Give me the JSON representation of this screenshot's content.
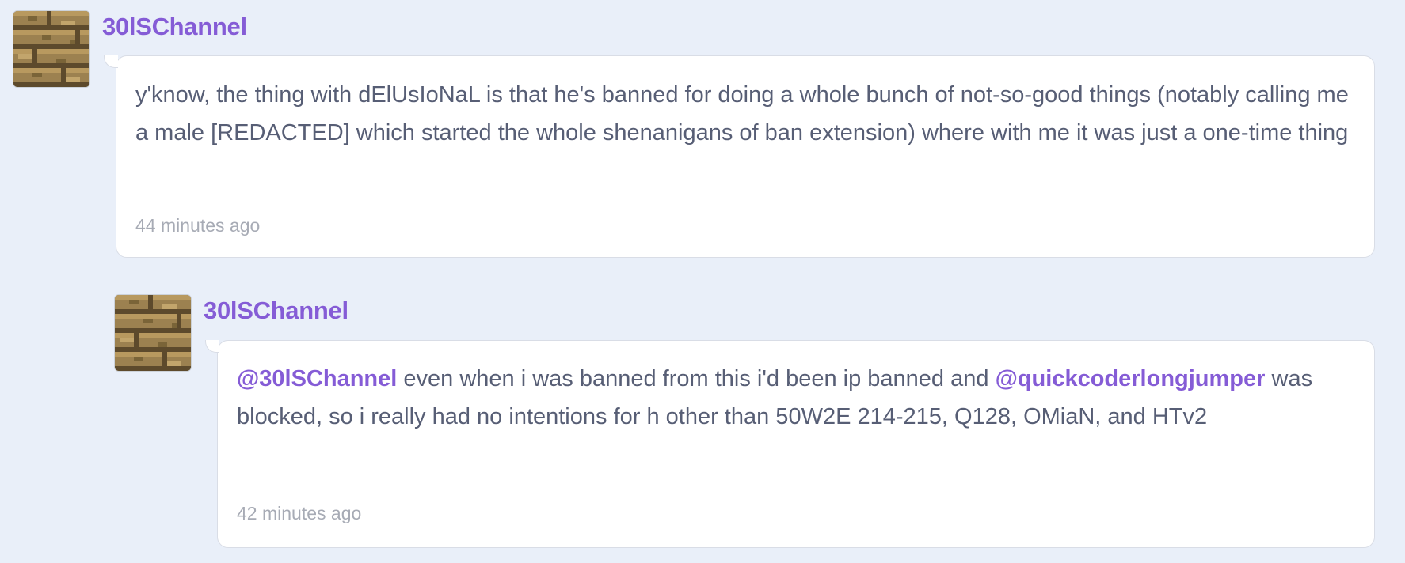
{
  "comments": [
    {
      "username": "30lSChannel",
      "avatar_icon": "wood-plank-avatar-icon",
      "text": "y'know, the thing with dElUsIoNaL is that he's banned for doing a whole bunch of not-so-good things (notably calling me a male [REDACTED] which started the whole shenanigans of ban extension) where with me it was just a one-time thing",
      "time": "44 minutes ago"
    },
    {
      "username": "30lSChannel",
      "avatar_icon": "wood-plank-avatar-icon",
      "mention1": "@30lSChannel",
      "text_part1": " even when i was banned from this i'd been ip banned and ",
      "mention2": "@quickcoderlongjumper",
      "text_part2": " was blocked, so i really had no intentions for h other than 50W2E 214-215, Q128, OMiaN, and HTv2",
      "time": "42 minutes ago"
    }
  ],
  "colors": {
    "background": "#e9eff9",
    "accent": "#855cd6",
    "text": "#575e75",
    "timestamp": "#a7abb5"
  }
}
